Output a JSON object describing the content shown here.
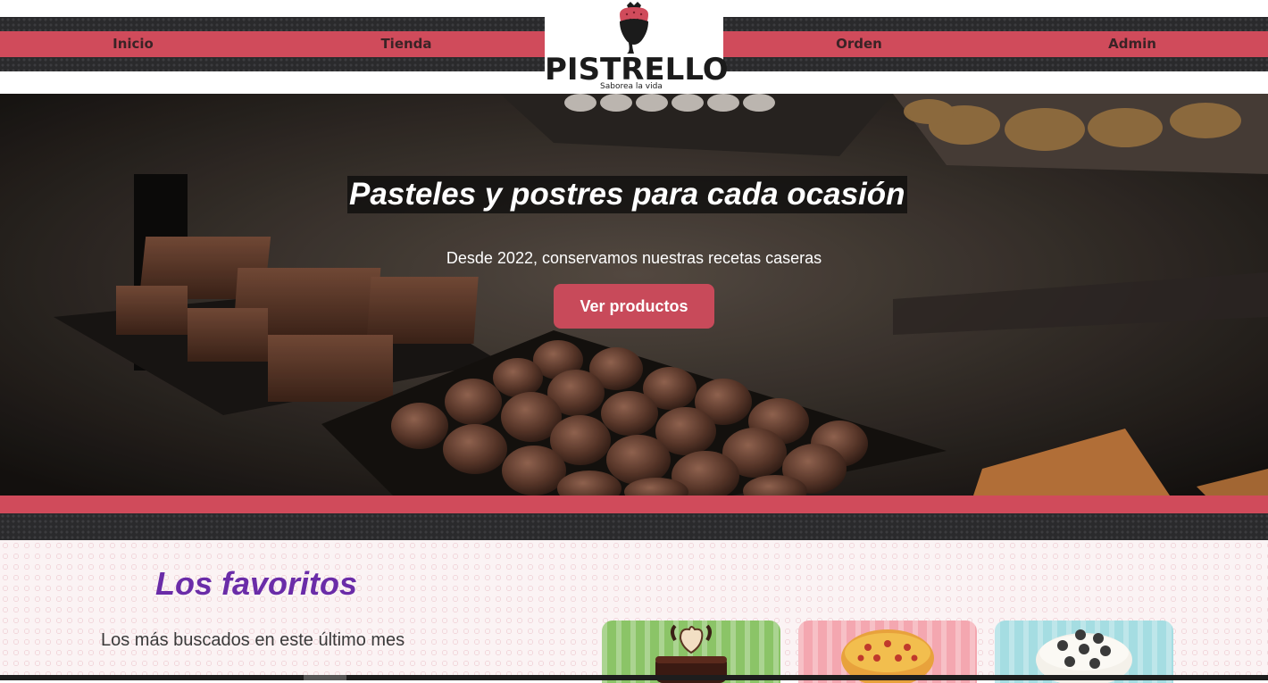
{
  "nav": {
    "items": [
      {
        "label": "Inicio"
      },
      {
        "label": "Tienda"
      },
      {
        "label": "Orden"
      },
      {
        "label": "Admin"
      }
    ]
  },
  "logo": {
    "name": "PISTRELLO",
    "tagline": "Saborea la vida"
  },
  "hero": {
    "title": "Pasteles y postres para cada ocasión",
    "subtitle": "Desde 2022, conservamos nuestras recetas caseras",
    "button_label": "Ver productos"
  },
  "favorites": {
    "title": "Los favoritos",
    "subtitle": "Los más buscados en este último mes",
    "cards": [
      {
        "image": "chocolate-heart-cake",
        "color": "#8bc467"
      },
      {
        "image": "pineapple-upside-down-cake",
        "color": "#f4a7b0"
      },
      {
        "image": "cookies-and-cream-cake",
        "color": "#a5dde2"
      }
    ]
  },
  "colors": {
    "accent": "#d04b5b",
    "button": "#c84a5a",
    "title_purple": "#6a2ca8",
    "dark_stripe": "#2a2a2c"
  }
}
